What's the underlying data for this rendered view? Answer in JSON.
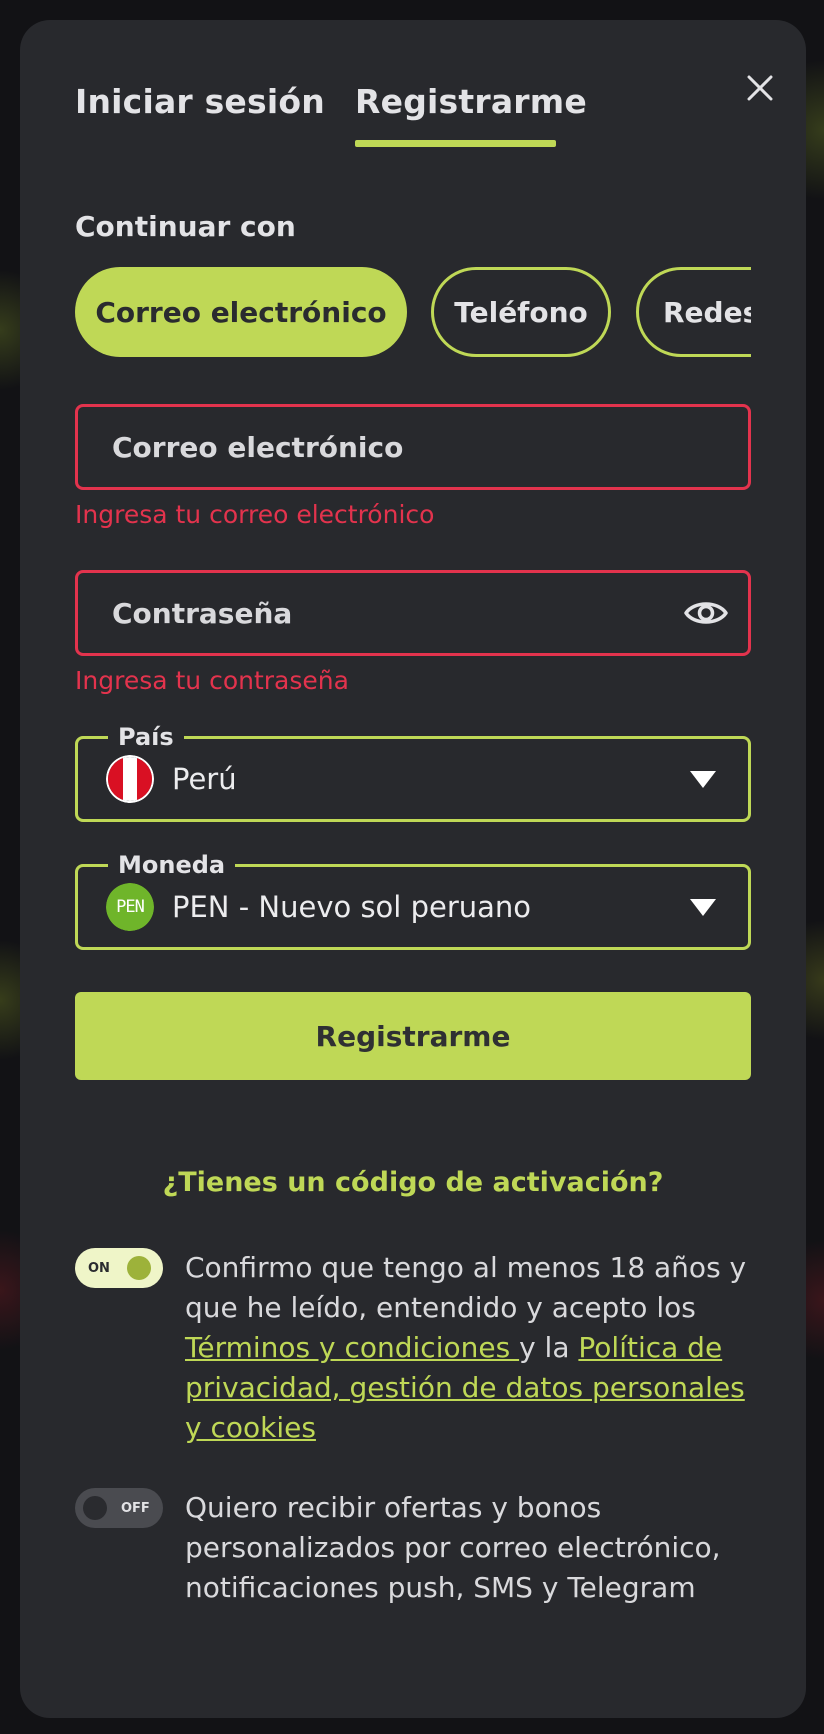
{
  "tabs": {
    "login": "Iniciar sesión",
    "register": "Registrarme",
    "active": "register"
  },
  "continue_with": "Continuar con",
  "methods": [
    "Correo electrónico",
    "Teléfono",
    "Redes"
  ],
  "email": {
    "placeholder": "Correo electrónico",
    "error": "Ingresa tu correo electrónico"
  },
  "password": {
    "placeholder": "Contraseña",
    "error": "Ingresa tu contraseña"
  },
  "country": {
    "label": "País",
    "value": "Perú"
  },
  "currency": {
    "label": "Moneda",
    "icon_text": "PEN",
    "value": "PEN - Nuevo sol peruano"
  },
  "submit_label": "Registrarme",
  "activation_link": "¿Tienes un código de activación?",
  "consent": {
    "toggle_label": "ON",
    "text_before": "Confirmo que tengo al menos 18 años y que he leído, entendido y acepto los ",
    "terms_link": "Términos y condiciones ",
    "text_middle": "y la ",
    "privacy_link": "Política de privacidad, gestión de datos personales y cookies",
    "checked": true
  },
  "offers": {
    "toggle_label": "OFF",
    "text": "Quiero recibir ofertas y bonos personalizados por correo electrónico, notificaciones push, SMS y Telegram",
    "checked": false
  },
  "colors": {
    "accent": "#bfd856",
    "error": "#e3334d",
    "panel": "#28292d"
  }
}
